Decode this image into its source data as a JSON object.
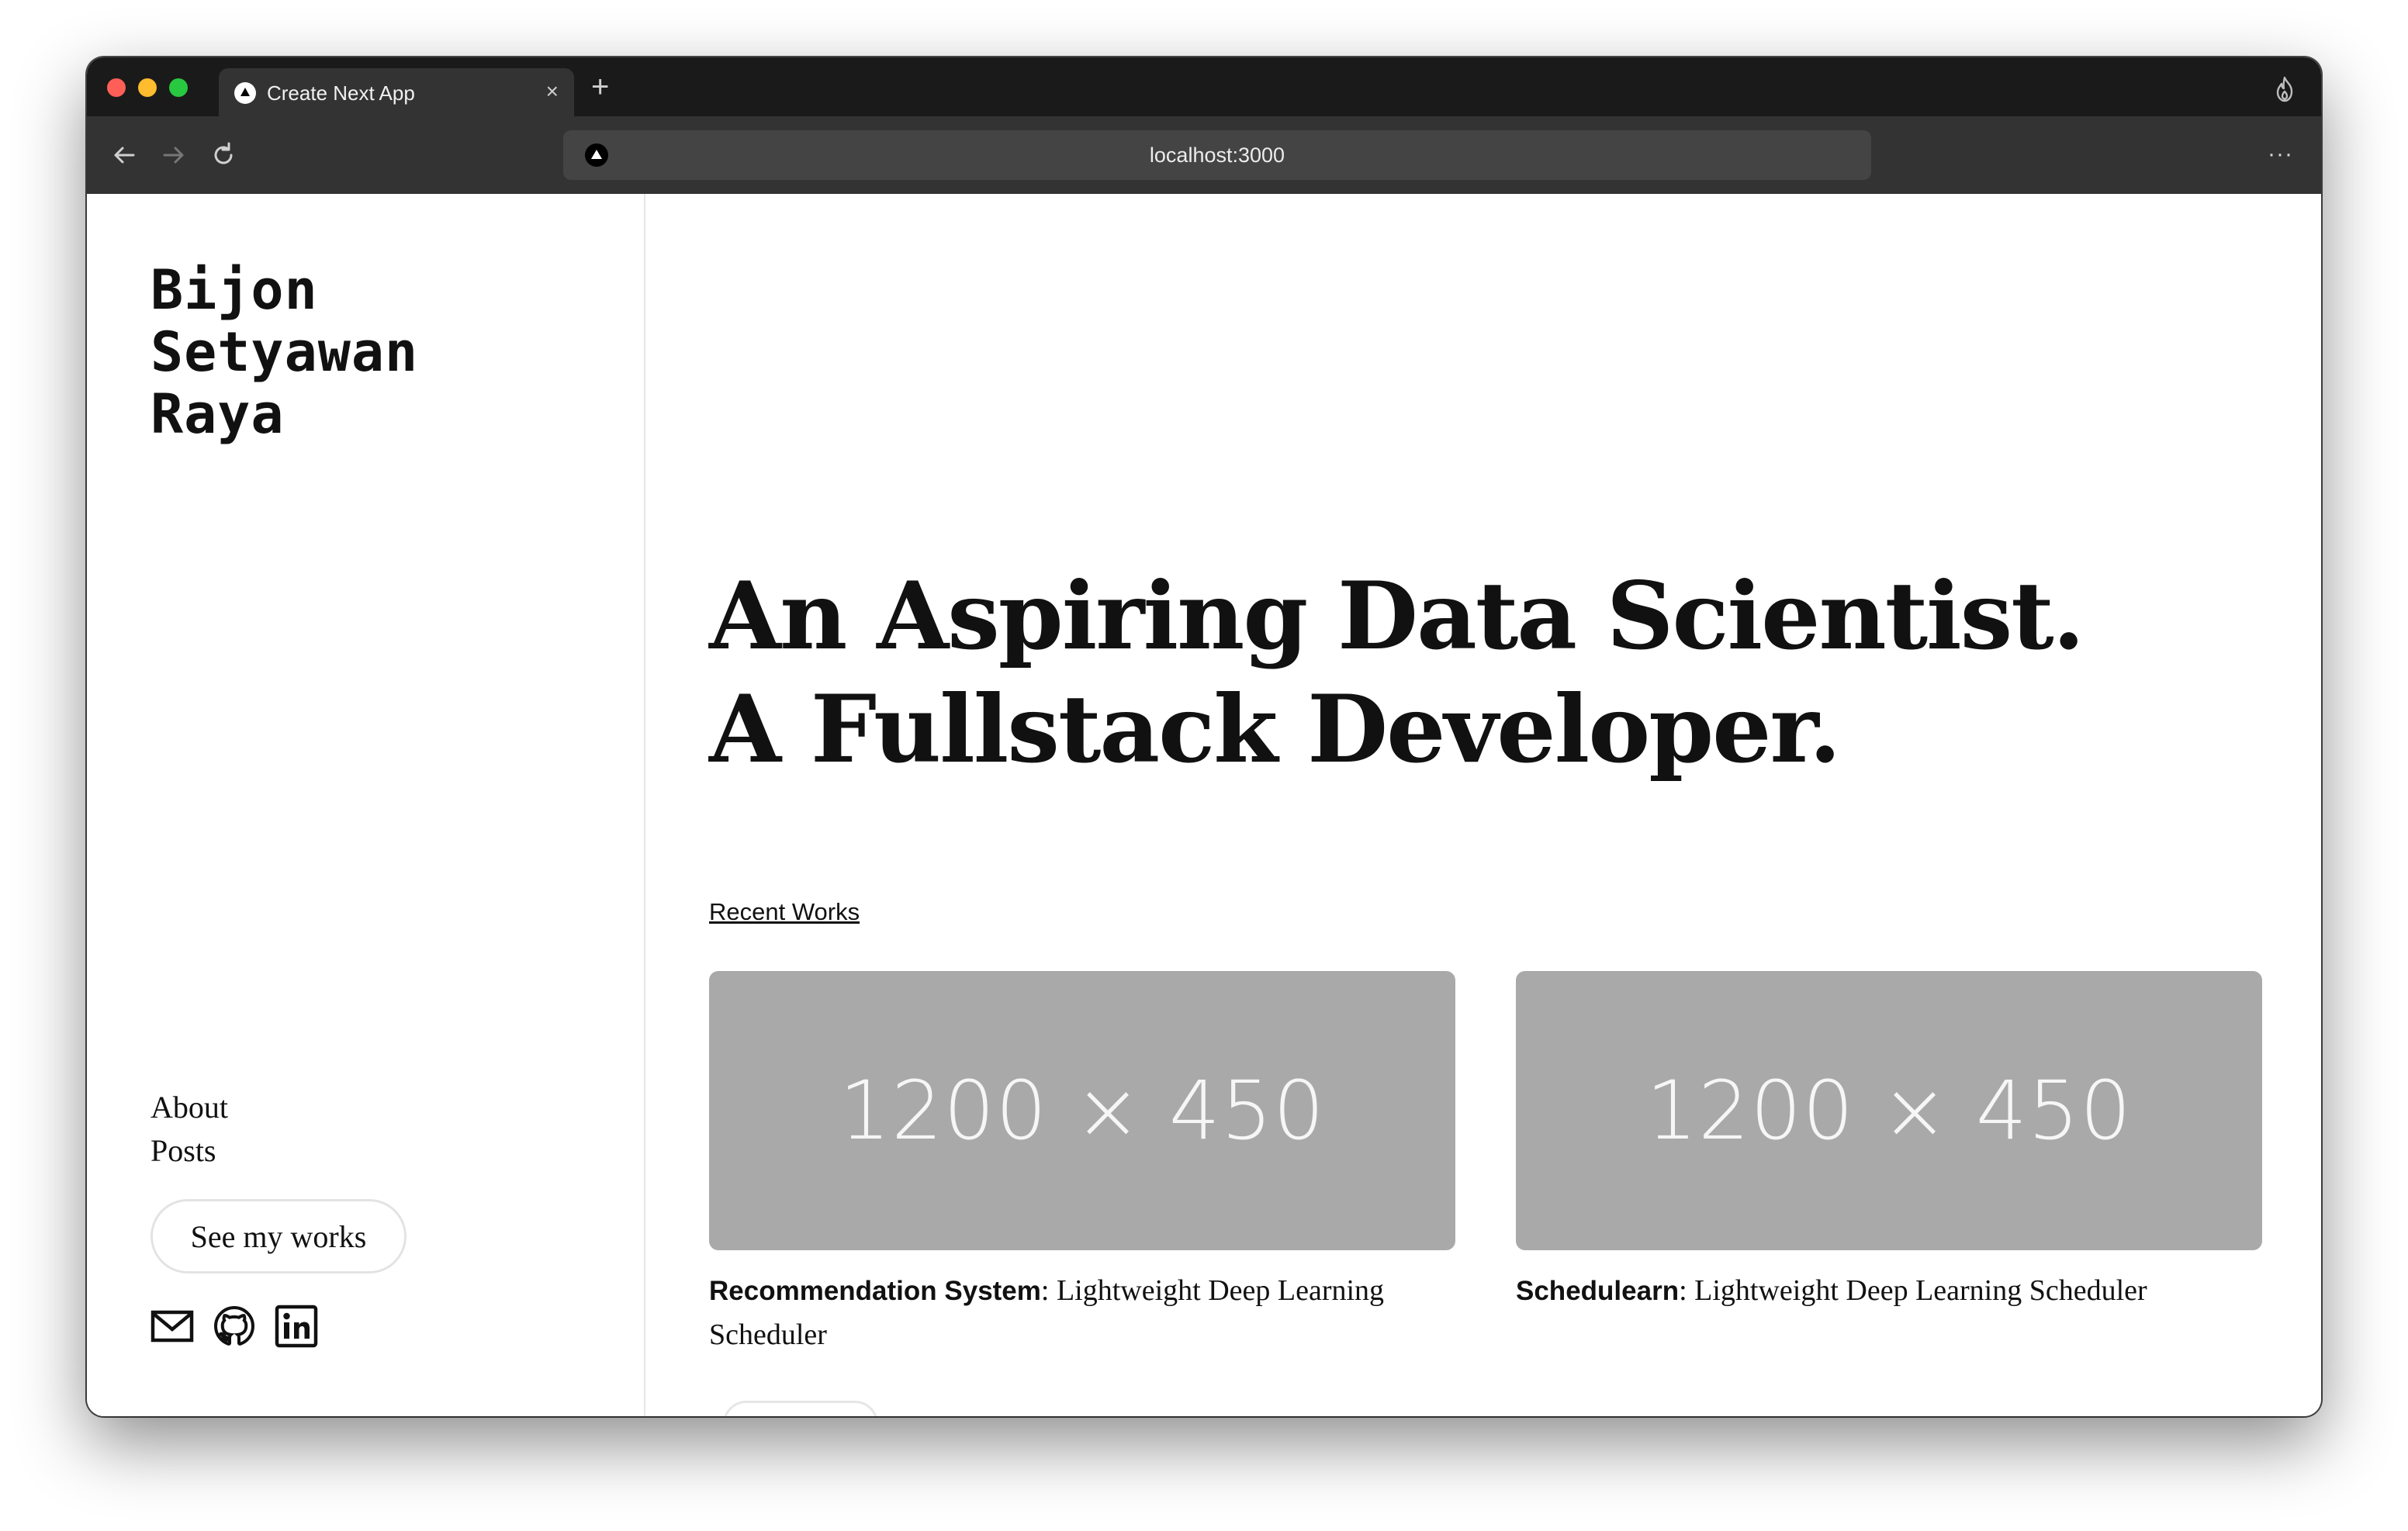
{
  "browser": {
    "tab_title": "Create Next App",
    "tab_close": "×",
    "new_tab": "+",
    "url": "localhost:3000",
    "more": "···"
  },
  "sidebar": {
    "title": "Bijon Setyawan Raya",
    "nav": [
      {
        "label": "About"
      },
      {
        "label": "Posts"
      }
    ],
    "cta_label": "See my works",
    "socials": [
      "mail-icon",
      "github-icon",
      "linkedin-icon"
    ]
  },
  "main": {
    "headline_line1": "An Aspiring Data Scientist.",
    "headline_line2": "A Fullstack Developer.",
    "recent_works_label": "Recent Works",
    "works": [
      {
        "image_text": "1200 × 450",
        "name": "Recommendation System",
        "description": "Lightweight Deep Learning Scheduler"
      },
      {
        "image_text": "1200 × 450",
        "name": "Schedulearn",
        "description": "Lightweight Deep Learning Scheduler"
      }
    ]
  },
  "colors": {
    "chrome_dark": "#1a1a1a",
    "toolbar": "#333333",
    "placeholder": "#a9a9a9",
    "text": "#111111"
  }
}
